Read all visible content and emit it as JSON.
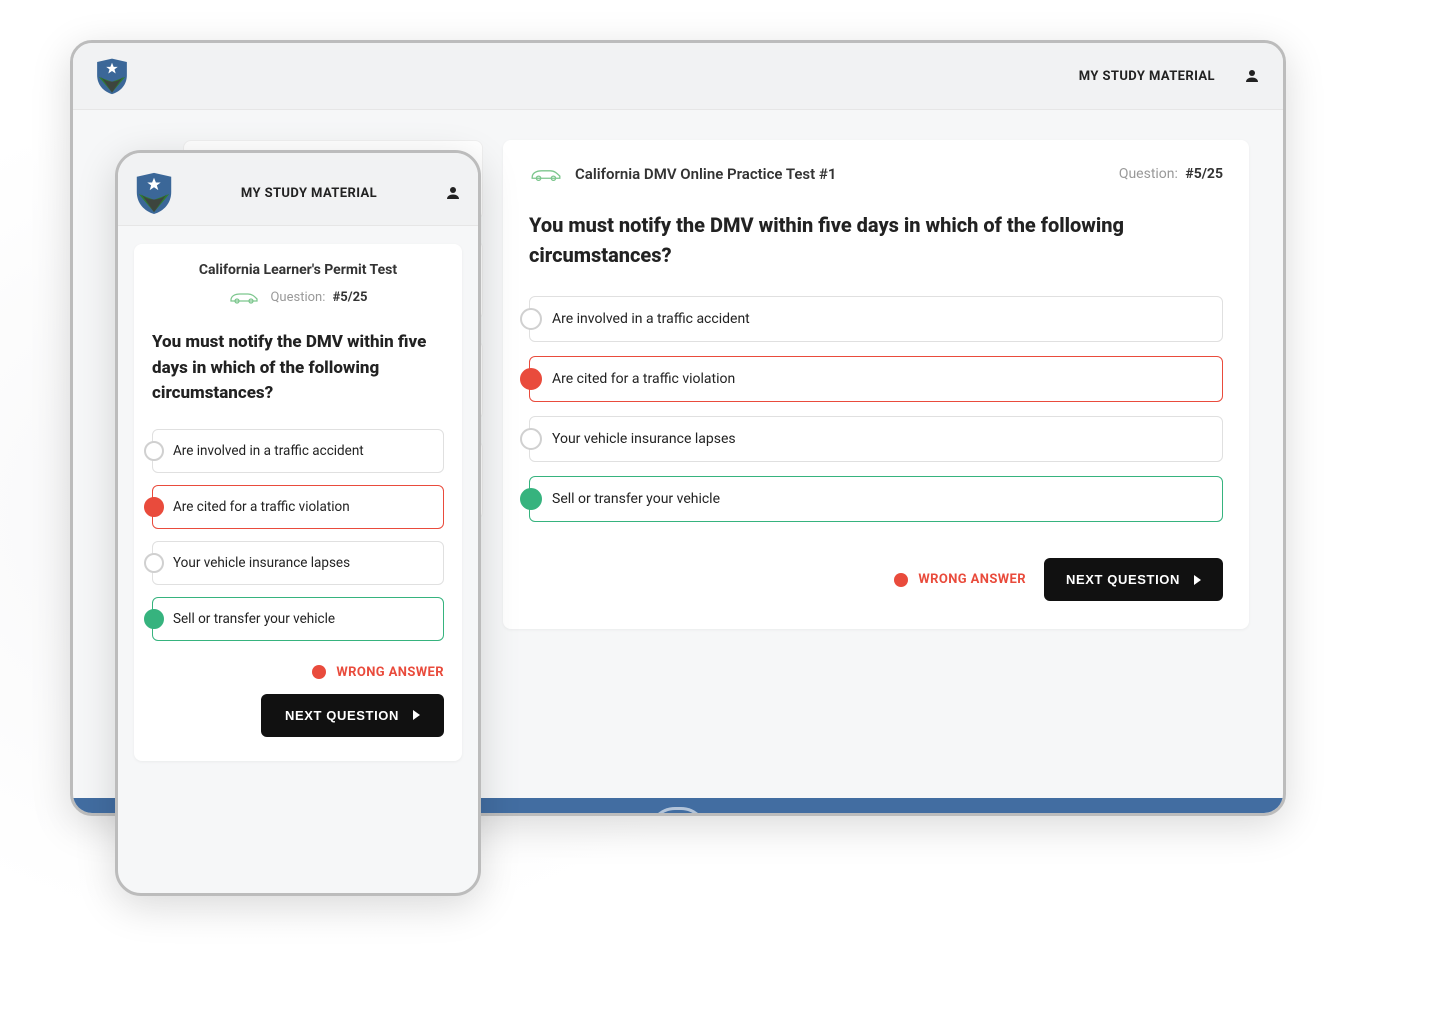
{
  "header": {
    "study_link": "MY STUDY MATERIAL"
  },
  "desktop": {
    "test_title": "California DMV Online Practice Test #1",
    "question_label": "Question:",
    "question_counter": "#5/25",
    "question_text": "You must notify the DMV within five days in which of the following circumstances?",
    "answers": [
      {
        "text": "Are involved in a traffic accident",
        "state": "neutral"
      },
      {
        "text": "Are cited for a traffic violation",
        "state": "wrong"
      },
      {
        "text": "Your vehicle insurance lapses",
        "state": "neutral"
      },
      {
        "text": "Sell or transfer your vehicle",
        "state": "correct"
      }
    ],
    "result_label": "WRONG ANSWER",
    "next_label": "NEXT QUESTION"
  },
  "mobile": {
    "test_title": "California Learner's Permit Test",
    "question_label": "Question:",
    "question_counter": "#5/25",
    "question_text": "You must notify the DMV within five days in which of the following circumstances?",
    "answers": [
      {
        "text": "Are involved in a traffic accident",
        "state": "neutral"
      },
      {
        "text": "Are cited for a traffic violation",
        "state": "wrong"
      },
      {
        "text": "Your vehicle insurance lapses",
        "state": "neutral"
      },
      {
        "text": "Sell or transfer your vehicle",
        "state": "correct"
      }
    ],
    "result_label": "WRONG ANSWER",
    "next_label": "NEXT QUESTION"
  }
}
